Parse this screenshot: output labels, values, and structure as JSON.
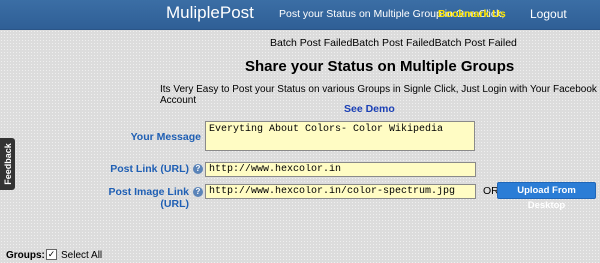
{
  "header": {
    "brand": "MuliplePost",
    "tagline": "Post your Status on Multiple Group in One Click,",
    "bookmark_label": "Bookmark Us",
    "logout_label": "Logout"
  },
  "status_message": "Batch Post FailedBatch Post FailedBatch Post Failed",
  "main": {
    "title": "Share your Status on Multiple Groups",
    "subtitle": "Its Very Easy to Post your Status on various Groups in Signle Click, Just Login with Your Facebook Account",
    "demo_link": "See Demo"
  },
  "form": {
    "message_label": "Your Message",
    "message_value": "Everyting About Colors- Color Wikipedia",
    "link_label": "Post Link (URL)",
    "link_value": "http://www.hexcolor.in",
    "image_label": "Post Image Link (URL)",
    "image_value": "http://www.hexcolor.in/color-spectrum.jpg",
    "or_text": "OR",
    "upload_label": "Upload From Desktop",
    "help_glyph": "?"
  },
  "feedback_tab": "Feedback",
  "groups": {
    "label": "Groups:",
    "select_all_label": "Select All",
    "select_all_checked": true,
    "checkmark": "✓"
  },
  "colors": {
    "header_bg": "#3b6ea5",
    "label_blue": "#1f5fb4",
    "bookmark_yellow": "#ffe600",
    "input_bg": "#fffcc4",
    "upload_button": "#2b7dd6"
  },
  "icons": {
    "help": "help-circle-icon",
    "checkbox": "checkbox-icon"
  }
}
